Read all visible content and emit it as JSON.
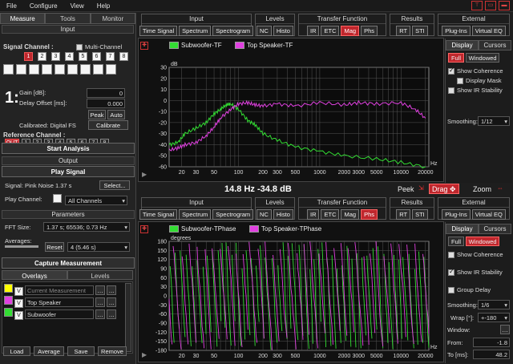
{
  "menu": {
    "file": "File",
    "configure": "Configure",
    "view": "View",
    "help": "Help"
  },
  "left": {
    "tabs": [
      "Measure",
      "Tools",
      "Monitor"
    ],
    "input_hdr": "Input",
    "signal_channel": "Signal Channel :",
    "multi_channel": "Multi-Channel",
    "channels": [
      "1",
      "2",
      "3",
      "4",
      "5",
      "6",
      "7",
      "8"
    ],
    "active_num": "1:",
    "gain_label": "Gain [dB]:",
    "gain_value": "0",
    "delay_label": "Delay Offset [ms]:",
    "delay_value": "0.000",
    "peak": "Peak",
    "auto": "Auto",
    "calibrated": "Calibrated: Digital FS",
    "calibrate": "Calibrate",
    "ref_channel": "Reference Channel :",
    "out": "OUT",
    "start": "Start Analysis",
    "output_hdr": "Output",
    "play_signal": "Play Signal",
    "signal_text": "Signal: Pink Noise  1.37 s",
    "select": "Select...",
    "play_channel": "Play Channel:",
    "all_channels": "All Channels",
    "params_hdr": "Parameters",
    "fft_size": "FFT Size:",
    "fft_value": "1.37 s; 65536; 0.73 Hz",
    "averages": "Averages:",
    "reset": "Reset",
    "avg_value": "4 (5.46 s)",
    "capture": "Capture Measurement",
    "overlays_tab": "Overlays",
    "levels_tab": "Levels",
    "overlays": [
      {
        "v": "V",
        "name": "Current Measurement",
        "color": "#ffff00"
      },
      {
        "v": "V",
        "name": "Top Speaker",
        "color": "#e040e0"
      },
      {
        "v": "V",
        "name": "Subwoofer",
        "color": "#33dd33"
      }
    ],
    "bottom": [
      "Load",
      "Average",
      "Save",
      "Remove"
    ]
  },
  "top": {
    "groups": [
      {
        "title": "Input",
        "buttons": [
          "Time Signal",
          "Spectrum",
          "Spectrogram"
        ]
      },
      {
        "title": "Levels",
        "buttons": [
          "NC",
          "Histo"
        ]
      },
      {
        "title": "Transfer Function",
        "buttons": [
          "IR",
          "ETC",
          "Mag",
          "Phs"
        ]
      },
      {
        "title": "Results",
        "buttons": [
          "RT",
          "STI"
        ]
      },
      {
        "title": "External",
        "buttons": [
          "Plug-Ins",
          "Virtual EQ"
        ]
      }
    ],
    "active": "Mag",
    "legend": [
      {
        "name": "Subwoofer-TF",
        "color": "#33dd33"
      },
      {
        "name": "Top Speaker-TF",
        "color": "#e040e0"
      }
    ],
    "unit": "dB",
    "yticks": [
      "30",
      "20",
      "10",
      "0",
      "-10",
      "-20",
      "-30",
      "-40",
      "-50",
      "-60"
    ],
    "xticks": [
      "20",
      "30",
      "50",
      "100",
      "200",
      "300",
      "500",
      "1000",
      "2000",
      "3000",
      "5000",
      "10000",
      "20000"
    ],
    "xunit": "Hz",
    "readout": "14.8 Hz  -34.8 dB",
    "peek": "Peek",
    "drag": "Drag",
    "zoom": "Zoom"
  },
  "bottom": {
    "groups": [
      {
        "title": "Input",
        "buttons": [
          "Time Signal",
          "Spectrum",
          "Spectrogram"
        ]
      },
      {
        "title": "Levels",
        "buttons": [
          "NC",
          "Histo"
        ]
      },
      {
        "title": "Transfer Function",
        "buttons": [
          "IR",
          "ETC",
          "Mag",
          "Phs"
        ]
      },
      {
        "title": "Results",
        "buttons": [
          "RT",
          "STI"
        ]
      },
      {
        "title": "External",
        "buttons": [
          "Plug-Ins",
          "Virtual EQ"
        ]
      }
    ],
    "active": "Phs",
    "legend": [
      {
        "name": "Subwoofer-TPhase",
        "color": "#33dd33"
      },
      {
        "name": "Top Speaker-TPhase",
        "color": "#e040e0"
      }
    ],
    "unit": "degrees",
    "yticks": [
      "180",
      "150",
      "120",
      "90",
      "60",
      "30",
      "0",
      "-30",
      "-60",
      "-90",
      "-120",
      "-150",
      "-180"
    ],
    "xticks": [
      "20",
      "30",
      "50",
      "100",
      "200",
      "300",
      "500",
      "1000",
      "2000",
      "3000",
      "5000",
      "10000",
      "20000"
    ],
    "xunit": "Hz"
  },
  "rtop": {
    "tabs": [
      "Display",
      "Cursors"
    ],
    "full": "Full",
    "windowed": "Windowed",
    "show_coherence": "Show Coherence",
    "display_mask": "Display Mask",
    "show_ir": "Show IR Stability",
    "smoothing": "Smoothing:",
    "smoothing_value": "1/12"
  },
  "rbot": {
    "tabs": [
      "Display",
      "Cursors"
    ],
    "full": "Full",
    "windowed": "Windowed",
    "show_coherence": "Show Coherence",
    "show_ir": "Show IR Stability",
    "group_delay": "Group Delay",
    "smoothing": "Smoothing:",
    "smoothing_value": "1/6",
    "wrap": "Wrap [°]:",
    "wrap_value": "+-180",
    "window": "Window:",
    "from": "From:",
    "from_value": "-1.8",
    "to": "To [ms]:",
    "to_value": "48.2"
  },
  "chart_data": [
    {
      "type": "line",
      "ylabel": "dB",
      "xlabel": "Hz",
      "xscale": "log",
      "xlim": [
        14,
        22000
      ],
      "ylim": [
        -60,
        30
      ],
      "series": [
        {
          "name": "Subwoofer-TF",
          "color": "#33dd33",
          "x": [
            14,
            18,
            22,
            30,
            40,
            50,
            60,
            70,
            80,
            100,
            130,
            160,
            200,
            300,
            500,
            1000,
            2000,
            5000,
            10000,
            20000
          ],
          "y": [
            -40,
            -38,
            -30,
            -25,
            -20,
            -12,
            -8,
            -4,
            -3,
            -8,
            -18,
            -22,
            -30,
            -36,
            -42,
            -46,
            -50,
            -53,
            -56,
            -60
          ]
        },
        {
          "name": "Top Speaker-TF",
          "color": "#e040e0",
          "x": [
            14,
            18,
            22,
            30,
            40,
            50,
            60,
            80,
            100,
            130,
            160,
            200,
            300,
            500,
            1000,
            2000,
            3000,
            5000,
            10000,
            15000,
            20000
          ],
          "y": [
            -45,
            -43,
            -40,
            -38,
            -32,
            -24,
            -16,
            -8,
            -3,
            -2,
            -4,
            -5,
            -3,
            -5,
            -2,
            -4,
            -2,
            -3,
            -2,
            -8,
            -16
          ]
        }
      ]
    },
    {
      "type": "line",
      "ylabel": "degrees",
      "xlabel": "Hz",
      "xscale": "log",
      "xlim": [
        14,
        22000
      ],
      "ylim": [
        -180,
        180
      ],
      "series": [
        {
          "name": "Subwoofer-TPhase",
          "color": "#33dd33"
        },
        {
          "name": "Top Speaker-TPhase",
          "color": "#e040e0"
        }
      ]
    }
  ]
}
